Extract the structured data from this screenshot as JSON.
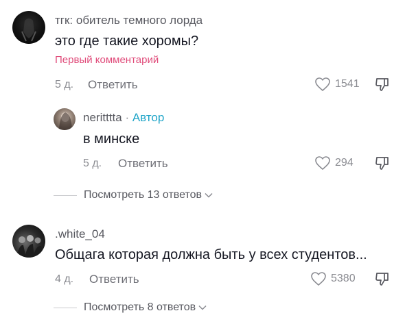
{
  "comments": [
    {
      "username": "тгк: обитель темного лорда",
      "text": "это где такие хоромы?",
      "pinned_label": "Первый комментарий",
      "time": "5 д.",
      "reply_label": "Ответить",
      "likes": "1541",
      "replies": [
        {
          "username": "neritttta",
          "separator": "·",
          "author_label": "Автор",
          "text": "в минске",
          "time": "5 д.",
          "reply_label": "Ответить",
          "likes": "294"
        }
      ],
      "view_replies_label": "Посмотреть 13 ответов"
    },
    {
      "username": ".white_04",
      "text": "Общага которая должна быть у всех студентов...",
      "time": "4 д.",
      "reply_label": "Ответить",
      "likes": "5380",
      "view_replies_label": "Посмотреть 8 ответов"
    }
  ],
  "colors": {
    "text": "#161823",
    "muted": "#8a8b91",
    "pinned": "#e04b7a",
    "author": "#20a5c8"
  }
}
